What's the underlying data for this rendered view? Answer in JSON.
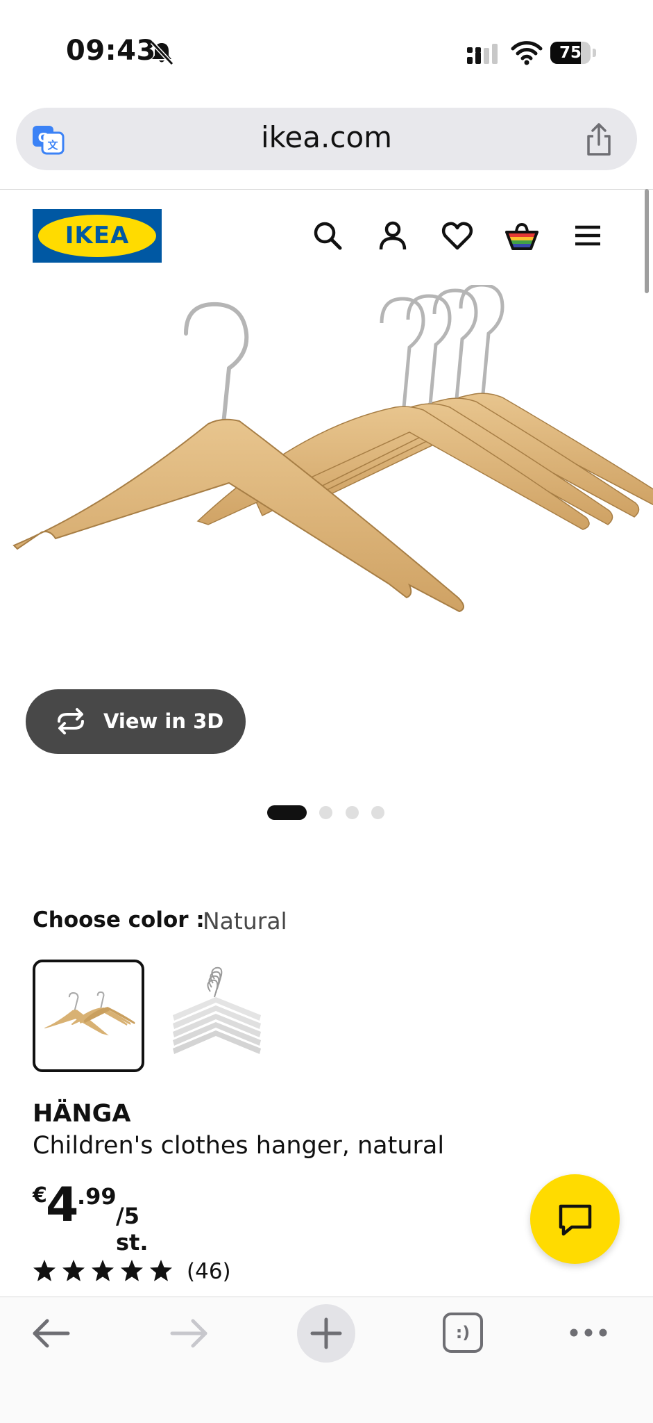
{
  "status_bar": {
    "time": "09:43",
    "battery_level": "75",
    "battery_fraction": 0.75,
    "icons": [
      "bell-slash-icon",
      "cellular-signal-icon",
      "wifi-icon",
      "battery-icon"
    ]
  },
  "browser": {
    "url": "ikea.com",
    "icons": [
      "translate-icon",
      "share-icon"
    ]
  },
  "header": {
    "logo_text": "IKEA",
    "brand_colors": {
      "blue": "#0058a3",
      "yellow": "#ffdb00"
    },
    "icons": [
      "search-icon",
      "account-icon",
      "heart-icon",
      "cart-icon",
      "menu-icon"
    ]
  },
  "gallery": {
    "view_3d_label": "View in 3D",
    "current_image": 1,
    "image_count": 4
  },
  "color_selector": {
    "label": "Choose color :",
    "selected": "Natural",
    "options": [
      "Natural",
      "White"
    ]
  },
  "product": {
    "name": "HÄNGA",
    "description": "Children's clothes hanger, natural",
    "price": {
      "currency": "€",
      "integer": "4",
      "decimal": ".99",
      "unit": "/5 st."
    },
    "rating": {
      "stars": 5,
      "max_stars": 5,
      "review_count": "(46)"
    }
  },
  "chat": {
    "icon": "chat-bubble-icon",
    "color": "#ffdb00"
  },
  "bottom_toolbar": {
    "tabs_label": ":)",
    "icons": [
      "back-arrow-icon",
      "forward-arrow-icon",
      "plus-icon",
      "tabs-icon",
      "more-icon"
    ]
  }
}
